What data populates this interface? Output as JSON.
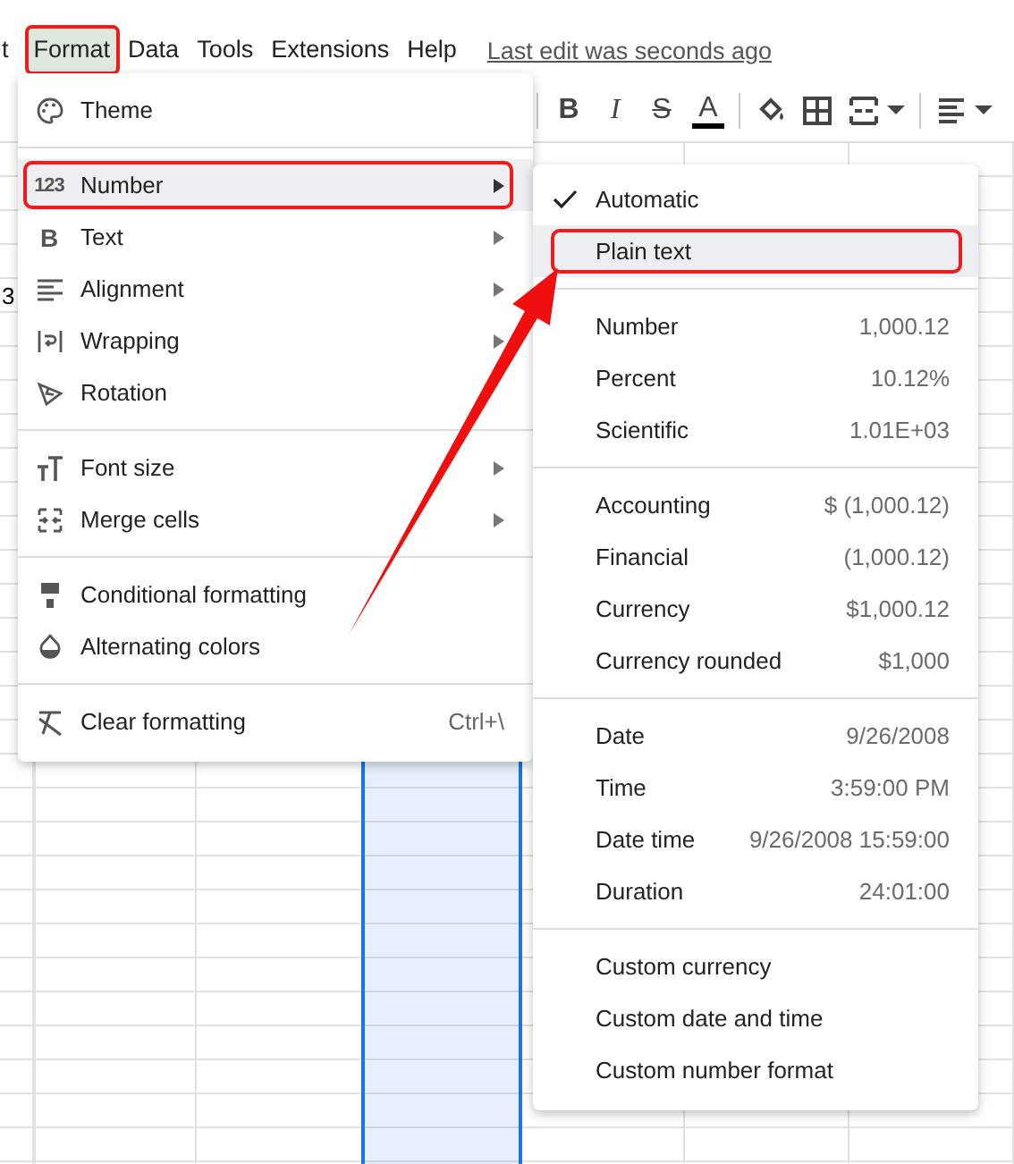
{
  "menu_bar": {
    "items": [
      {
        "label": "t",
        "selected": false,
        "outlined": false
      },
      {
        "label": "Format",
        "selected": true,
        "outlined": true
      },
      {
        "label": "Data",
        "selected": false,
        "outlined": false
      },
      {
        "label": "Tools",
        "selected": false,
        "outlined": false
      },
      {
        "label": "Extensions",
        "selected": false,
        "outlined": false
      },
      {
        "label": "Help",
        "selected": false,
        "outlined": false
      }
    ],
    "last_edit_link": "Last edit was seconds ago"
  },
  "toolbar": {
    "items": [
      {
        "kind": "bold",
        "glyph": "B"
      },
      {
        "kind": "italic",
        "glyph": "I"
      },
      {
        "kind": "strike",
        "glyph": "S"
      },
      {
        "kind": "text_color",
        "glyph": "A"
      },
      {
        "kind": "fill"
      },
      {
        "kind": "borders"
      },
      {
        "kind": "merge"
      },
      {
        "kind": "align"
      }
    ]
  },
  "grid": {
    "columns": [
      {
        "selected": false
      },
      {
        "selected": false
      },
      {
        "selected": false
      },
      {
        "selected": true
      },
      {
        "selected": false
      },
      {
        "selected": false
      },
      {
        "selected": false
      }
    ],
    "clipped_cell": "3"
  },
  "format_menu": {
    "groups": [
      [
        {
          "label": "Theme",
          "kind": "palette",
          "highlighted": false,
          "outlined": false,
          "submenu": false
        }
      ],
      [
        {
          "label": "Number",
          "kind": "glyph",
          "glyph": "123",
          "highlighted": true,
          "outlined": true,
          "submenu": true
        },
        {
          "label": "Text",
          "kind": "glyph",
          "glyph": "B",
          "highlighted": false,
          "outlined": false,
          "submenu": true
        },
        {
          "label": "Alignment",
          "kind": "align",
          "highlighted": false,
          "outlined": false,
          "submenu": true
        },
        {
          "label": "Wrapping",
          "kind": "wrap",
          "highlighted": false,
          "outlined": false,
          "submenu": true
        },
        {
          "label": "Rotation",
          "kind": "rotate",
          "highlighted": false,
          "outlined": false,
          "submenu": false
        }
      ],
      [
        {
          "label": "Font size",
          "kind": "fontsize",
          "highlighted": false,
          "outlined": false,
          "submenu": true
        },
        {
          "label": "Merge cells",
          "kind": "merge",
          "highlighted": false,
          "outlined": false,
          "submenu": true
        }
      ],
      [
        {
          "label": "Conditional formatting",
          "kind": "paintformat",
          "highlighted": false,
          "outlined": false,
          "submenu": false
        },
        {
          "label": "Alternating colors",
          "kind": "droplet",
          "highlighted": false,
          "outlined": false,
          "submenu": false
        }
      ],
      [
        {
          "label": "Clear formatting",
          "kind": "clear",
          "shortcut": "Ctrl+\\",
          "highlighted": false,
          "outlined": false,
          "submenu": false
        }
      ]
    ]
  },
  "number_submenu": {
    "groups": [
      [
        {
          "label": "Automatic",
          "checked": true,
          "highlighted": false,
          "outlined": false
        },
        {
          "label": "Plain text",
          "checked": false,
          "highlighted": true,
          "outlined": true
        }
      ],
      [
        {
          "label": "Number",
          "example": "1,000.12",
          "checked": false,
          "highlighted": false,
          "outlined": false
        },
        {
          "label": "Percent",
          "example": "10.12%",
          "checked": false,
          "highlighted": false,
          "outlined": false
        },
        {
          "label": "Scientific",
          "example": "1.01E+03",
          "checked": false,
          "highlighted": false,
          "outlined": false
        }
      ],
      [
        {
          "label": "Accounting",
          "example": "$ (1,000.12)",
          "checked": false,
          "highlighted": false,
          "outlined": false
        },
        {
          "label": "Financial",
          "example": "(1,000.12)",
          "checked": false,
          "highlighted": false,
          "outlined": false
        },
        {
          "label": "Currency",
          "example": "$1,000.12",
          "checked": false,
          "highlighted": false,
          "outlined": false
        },
        {
          "label": "Currency rounded",
          "example": "$1,000",
          "checked": false,
          "highlighted": false,
          "outlined": false
        }
      ],
      [
        {
          "label": "Date",
          "example": "9/26/2008",
          "checked": false,
          "highlighted": false,
          "outlined": false
        },
        {
          "label": "Time",
          "example": "3:59:00 PM",
          "checked": false,
          "highlighted": false,
          "outlined": false
        },
        {
          "label": "Date time",
          "example": "9/26/2008 15:59:00",
          "checked": false,
          "highlighted": false,
          "outlined": false
        },
        {
          "label": "Duration",
          "example": "24:01:00",
          "checked": false,
          "highlighted": false,
          "outlined": false
        }
      ],
      [
        {
          "label": "Custom currency",
          "checked": false,
          "highlighted": false,
          "outlined": false
        },
        {
          "label": "Custom date and time",
          "checked": false,
          "highlighted": false,
          "outlined": false
        },
        {
          "label": "Custom number format",
          "checked": false,
          "highlighted": false,
          "outlined": false
        }
      ]
    ]
  }
}
